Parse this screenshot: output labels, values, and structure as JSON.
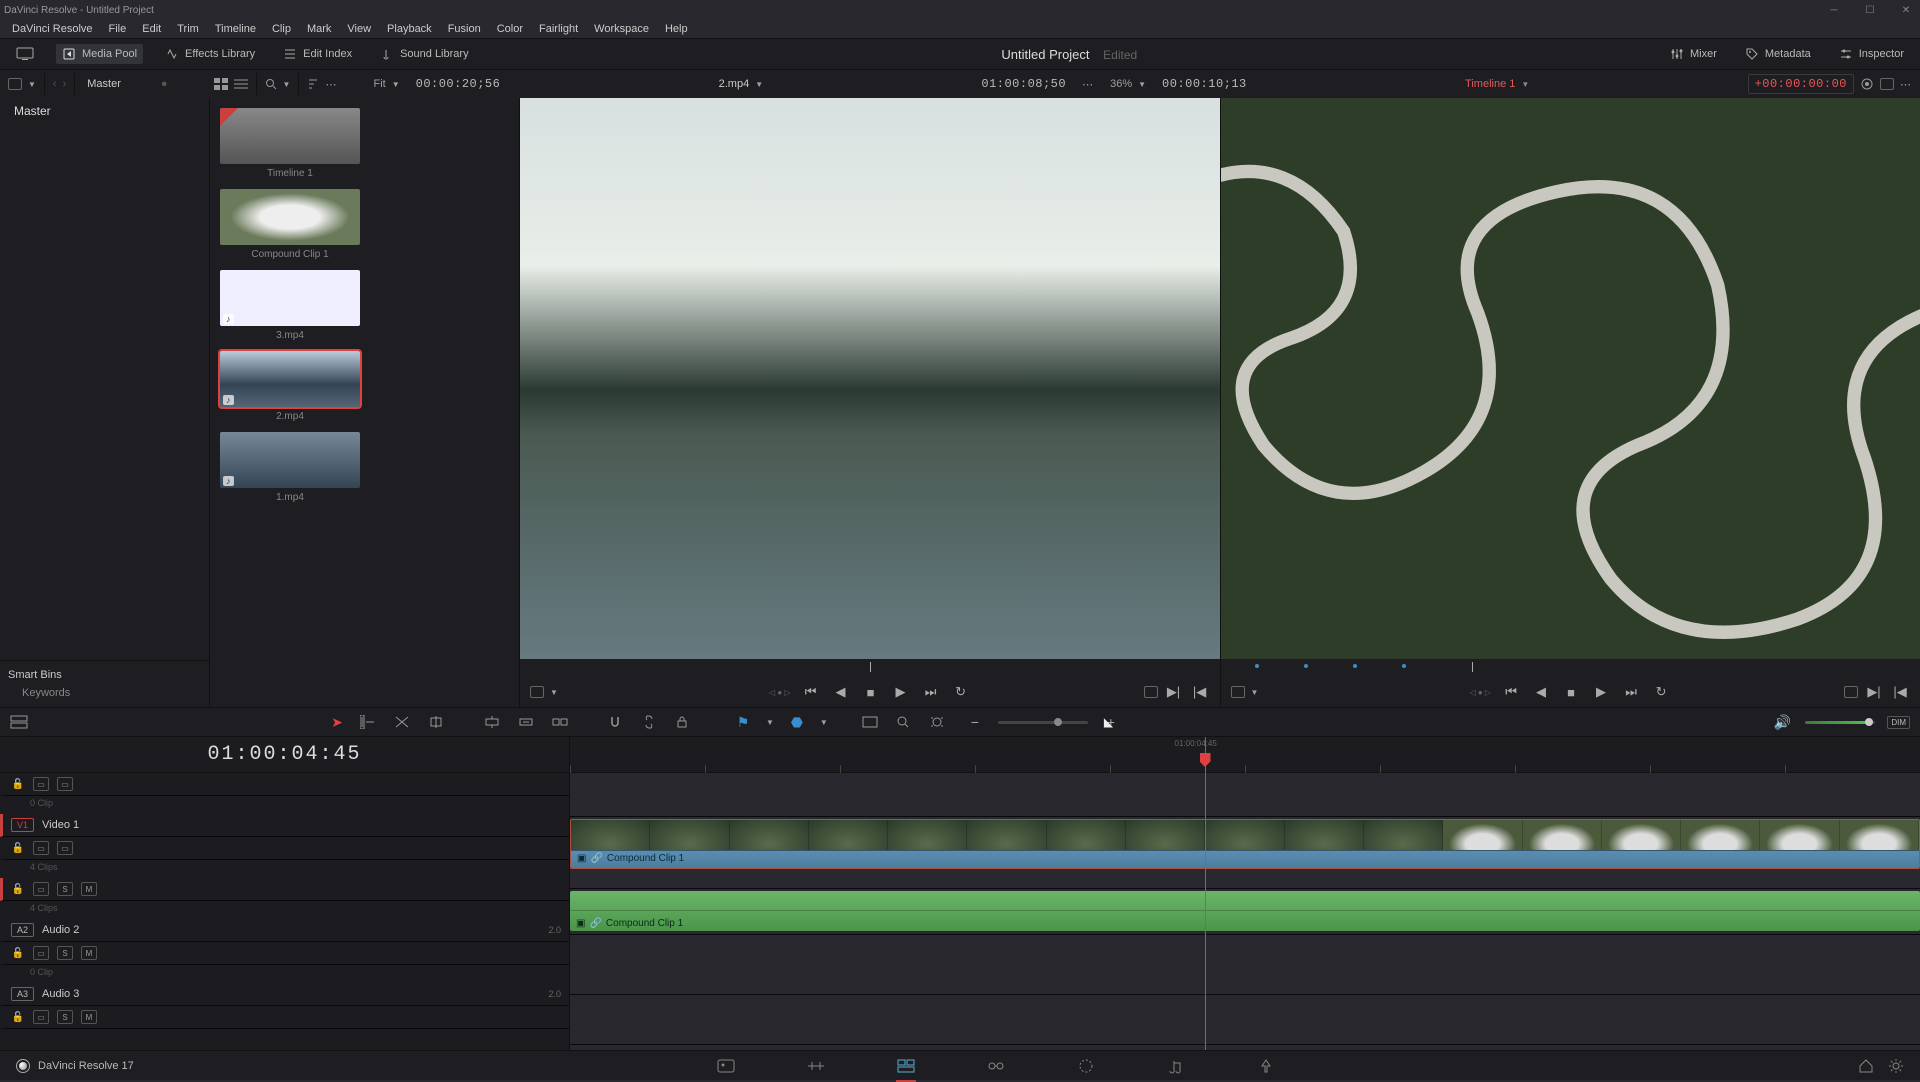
{
  "titlebar": {
    "text": "DaVinci Resolve - Untitled Project"
  },
  "menu": [
    "DaVinci Resolve",
    "File",
    "Edit",
    "Trim",
    "Timeline",
    "Clip",
    "Mark",
    "View",
    "Playback",
    "Fusion",
    "Color",
    "Fairlight",
    "Workspace",
    "Help"
  ],
  "top_toolbar": {
    "media_pool": "Media Pool",
    "effects_library": "Effects Library",
    "edit_index": "Edit Index",
    "sound_library": "Sound Library",
    "project": "Untitled Project",
    "edited": "Edited",
    "mixer": "Mixer",
    "metadata": "Metadata",
    "inspector": "Inspector"
  },
  "secondary_bar": {
    "master": "Master",
    "fit": "Fit",
    "src_tc": "00:00:20;56",
    "clip_name": "2.mp4",
    "src_dur": "01:00:08;50",
    "zoom": "36%",
    "rec_tc": "00:00:10;13",
    "timeline_name": "Timeline 1",
    "offset_tc": "+00:00:00:00"
  },
  "bins": {
    "master": "Master",
    "smart_bins": "Smart Bins",
    "keywords": "Keywords"
  },
  "media": [
    {
      "label": "Timeline 1",
      "type": "timeline"
    },
    {
      "label": "Compound Clip 1",
      "type": "clip"
    },
    {
      "label": "3.mp4",
      "type": "clip",
      "audio": true
    },
    {
      "label": "2.mp4",
      "type": "clip",
      "selected": true,
      "audio": true
    },
    {
      "label": "1.mp4",
      "type": "clip",
      "audio": true
    }
  ],
  "timeline": {
    "tc": "01:00:04:45",
    "playhead_tc": "01:00:04:45",
    "tracks": {
      "v2_clips": "0 Clip",
      "v1_badge": "V1",
      "v1_name": "Video 1",
      "v1_clips": "4 Clips",
      "a1_clips": "4 Clips",
      "a2_badge": "A2",
      "a2_name": "Audio 2",
      "a2_ch": "2.0",
      "a2_clips": "0 Clip",
      "a3_badge": "A3",
      "a3_name": "Audio 3",
      "a3_ch": "2.0"
    },
    "clips": {
      "compound_video": "Compound Clip 1",
      "compound_audio": "Compound Clip 1"
    }
  },
  "page_bar": {
    "version": "DaVinci Resolve 17"
  },
  "tl_toolbar": {
    "dim": "DIM"
  }
}
